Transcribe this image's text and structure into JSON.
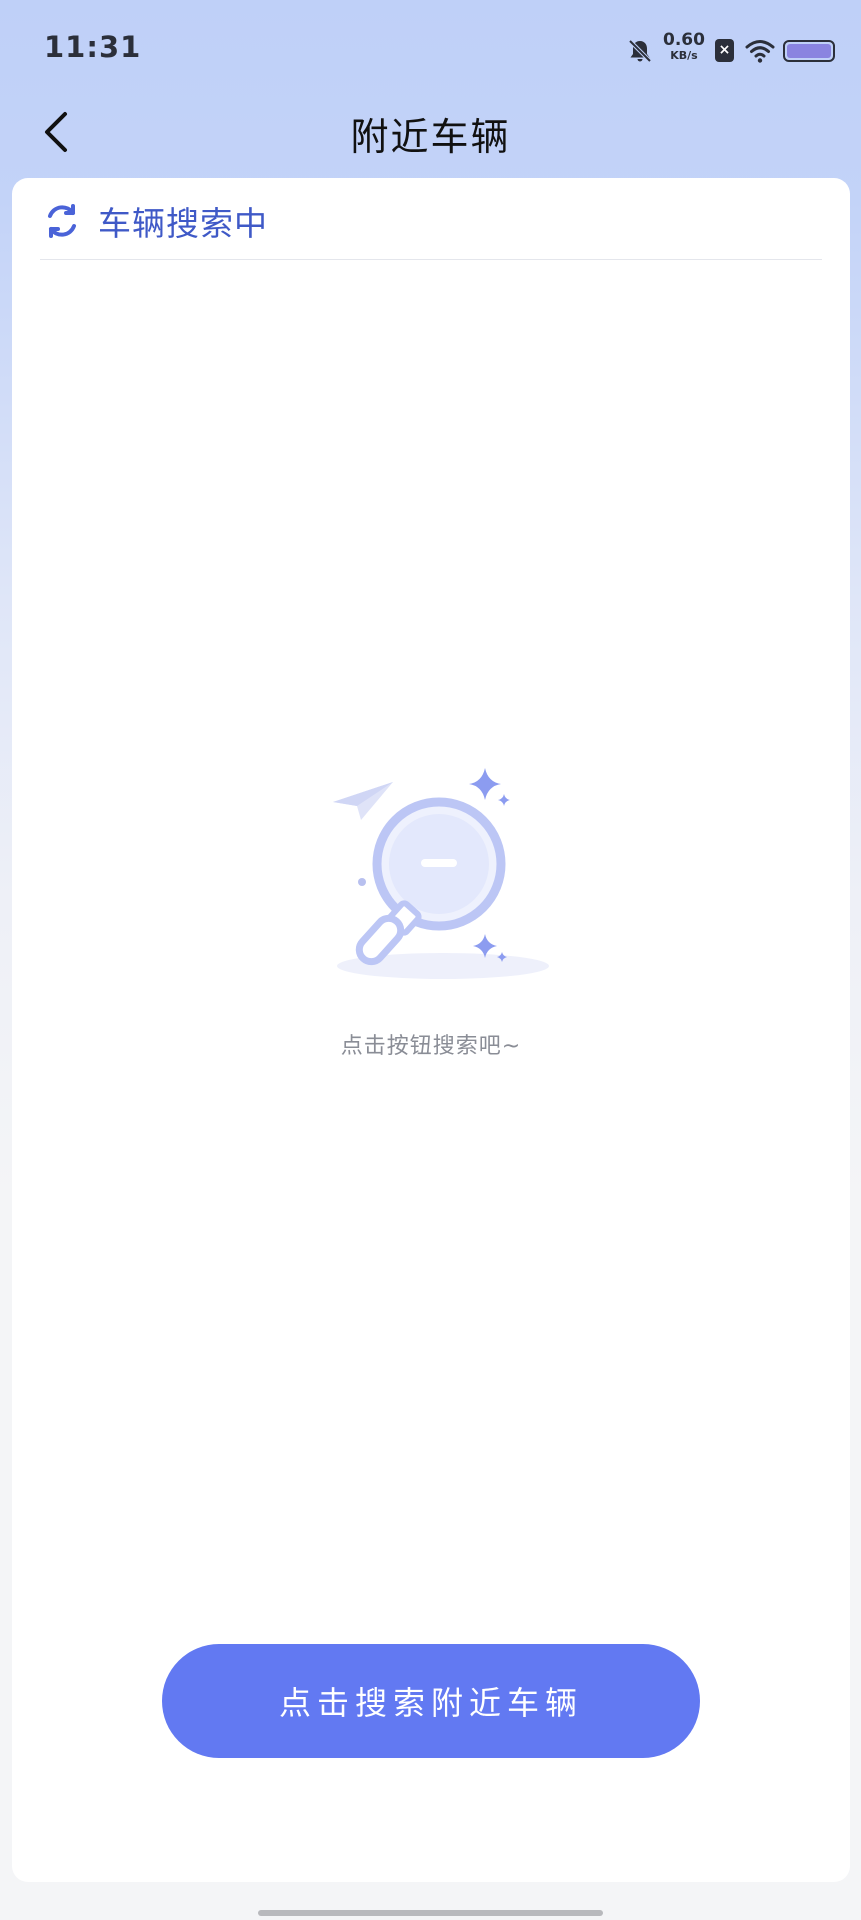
{
  "status_bar": {
    "time": "11:31",
    "net_speed_value": "0.60",
    "net_speed_unit": "KB/s",
    "sim_label": "×",
    "icons": [
      "bell-muted-icon",
      "sim-off-icon",
      "wifi-icon",
      "battery-icon"
    ]
  },
  "nav": {
    "title": "附近车辆",
    "back_icon": "chevron-left-icon"
  },
  "search_status": {
    "icon": "refresh-icon",
    "label": "车辆搜索中"
  },
  "empty_state": {
    "illustration": "magnifier-search-illustration",
    "hint": "点击按钮搜索吧~"
  },
  "action": {
    "search_button_label": "点击搜索附近车辆"
  },
  "colors": {
    "accent": "#6279f2",
    "status_text": "#3f59c7",
    "header_bg": "#bfd0f8"
  }
}
